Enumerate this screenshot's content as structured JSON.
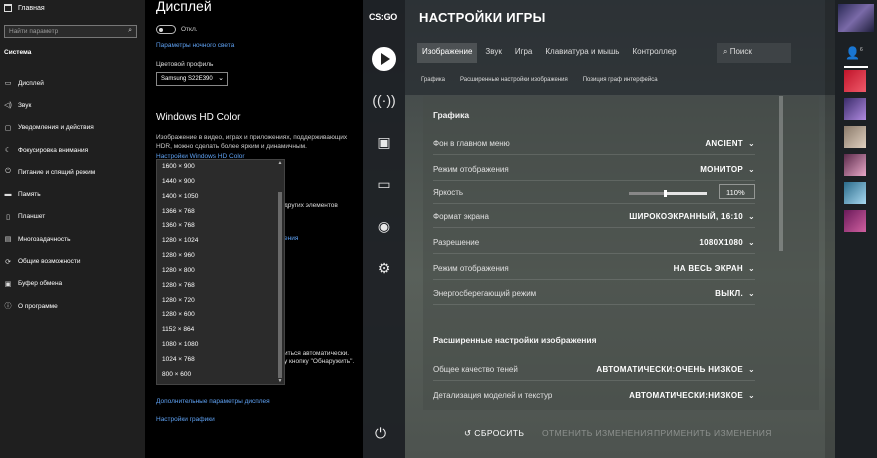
{
  "win_nav": {
    "home_label": "Главная",
    "search_placeholder": "Найти параметр",
    "section_title": "Система",
    "items": [
      {
        "label": "Дисплей",
        "icon": "monitor-icon",
        "glyph": "▭"
      },
      {
        "label": "Звук",
        "icon": "speaker-icon",
        "glyph": "◁)"
      },
      {
        "label": "Уведомления и действия",
        "icon": "notification-icon",
        "glyph": "▢"
      },
      {
        "label": "Фокусировка внимания",
        "icon": "moon-icon",
        "glyph": "☾"
      },
      {
        "label": "Питание и спящий режим",
        "icon": "power-icon",
        "glyph": "⏻"
      },
      {
        "label": "Память",
        "icon": "storage-icon",
        "glyph": "▬"
      },
      {
        "label": "Планшет",
        "icon": "tablet-icon",
        "glyph": "▯"
      },
      {
        "label": "Многозадачность",
        "icon": "multitask-icon",
        "glyph": "▤"
      },
      {
        "label": "Общие возможности",
        "icon": "shared-icon",
        "glyph": "⟳"
      },
      {
        "label": "Буфер обмена",
        "icon": "clipboard-icon",
        "glyph": "▣"
      },
      {
        "label": "О программе",
        "icon": "info-icon",
        "glyph": "ⓘ"
      }
    ]
  },
  "win_content": {
    "title": "Дисплей",
    "night_toggle_state": "Откл.",
    "night_link": "Параметры ночного света",
    "color_profile_label": "Цветовой профиль",
    "color_profile_value": "Samsung S22E390",
    "hd_title": "Windows HD Color",
    "hd_desc": "Изображение в видео, играх и приложениях, поддерживающих HDR, можно сделать более ярким и динамичным.",
    "hd_link": "Настройки Windows HD Color",
    "frag_scale": "других элементов",
    "frag_link": "ения",
    "frag_auto": "иться автоматически.",
    "frag_detect": "у кнопку \"Обнаружить\".",
    "adv_link": "Дополнительные параметры дисплея",
    "graphics_link": "Настройки графики",
    "resolutions": [
      "1600 × 900",
      "1440 × 900",
      "1400 × 1050",
      "1366 × 768",
      "1360 × 768",
      "1280 × 1024",
      "1280 × 960",
      "1280 × 800",
      "1280 × 768",
      "1280 × 720",
      "1280 × 600",
      "1152 × 864",
      "1080 × 1080",
      "1024 × 768",
      "800 × 600"
    ]
  },
  "csgo": {
    "logo": "CS:GO",
    "title": "НАСТРОЙКИ ИГРЫ",
    "tabs": [
      "Изображение",
      "Звук",
      "Игра",
      "Клавиатура и мышь",
      "Контроллер"
    ],
    "search_label": "Поиск",
    "subtabs": [
      "Графика",
      "Расширенные настройки изображения",
      "Позиция граф интерфейса"
    ],
    "section_graphics": "Графика",
    "rows": [
      {
        "label": "Фон в главном меню",
        "value": "ANCIENT"
      },
      {
        "label": "Режим отображения",
        "value": "МОНИТОР"
      },
      {
        "label": "Яркость",
        "value": "110%"
      },
      {
        "label": "Формат экрана",
        "value": "ШИРОКОЭКРАННЫЙ, 16:10"
      },
      {
        "label": "Разрешение",
        "value": "1080X1080"
      },
      {
        "label": "Режим отображения",
        "value": "НА ВЕСЬ ЭКРАН"
      },
      {
        "label": "Энергосберегающий режим",
        "value": "ВЫКЛ."
      }
    ],
    "brightness_fraction": 0.46,
    "section_advanced": "Расширенные настройки изображения",
    "adv_rows": [
      {
        "label": "Общее качество теней",
        "value": "АВТОМАТИЧЕСКИ:ОЧЕНЬ НИЗКОЕ"
      },
      {
        "label": "Детализация моделей и текстур",
        "value": "АВТОМАТИЧЕСКИ:НИЗКОЕ"
      }
    ],
    "btn_reset": "СБРОСИТЬ",
    "btn_cancel": "ОТМЕНИТЬ ИЗМЕНЕНИЯ",
    "btn_apply": "ПРИМЕНИТЬ ИЗМЕНЕНИЯ"
  },
  "friends": {
    "count": "6"
  }
}
